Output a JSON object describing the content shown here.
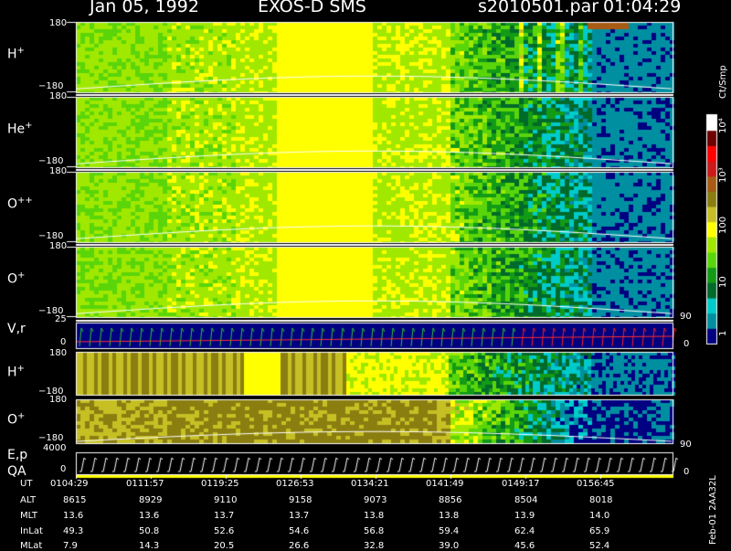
{
  "header": {
    "title_date": "Jan 05, 1992",
    "title_instrument": "EXOS-D SMS",
    "title_file": "s2010501.par",
    "title_time": "01:04:29"
  },
  "colorbar": {
    "unit_label": "Ct/Smp",
    "tick_labels": [
      "1",
      "10",
      "100",
      "10³",
      "10⁴"
    ],
    "colors": [
      "#000080",
      "#008fa0",
      "#00cbcb",
      "#006a2a",
      "#139b16",
      "#5ad50a",
      "#a0e800",
      "#ffff00",
      "#c6c025",
      "#8a7e10",
      "#a85b14",
      "#cc1a1a",
      "#ff0000",
      "#6f0000",
      "#ffffff"
    ]
  },
  "footer_tag": "Feb-01 2AA32L",
  "chart_data": {
    "type": "heatmap",
    "x_label": "UT",
    "x_ticks": [
      "0104:29",
      "0111:57",
      "0119:25",
      "0126:53",
      "0134:21",
      "0141:49",
      "0149:17",
      "0156:45"
    ],
    "panels": [
      {
        "label": "H",
        "charge": "+",
        "y_top": "180",
        "y_bottom": "−180"
      },
      {
        "label": "He",
        "charge": "+",
        "y_top": "180",
        "y_bottom": "−180"
      },
      {
        "label": "O",
        "charge": "++",
        "y_top": "180",
        "y_bottom": "−180"
      },
      {
        "label": "O",
        "charge": "+",
        "y_top": "180",
        "y_bottom": "−180",
        "right_tick": "90"
      },
      {
        "label": "V,r",
        "charge": "",
        "y_top": "25",
        "y_bottom": "0",
        "right_tick": "0"
      },
      {
        "label": "H",
        "charge": "+",
        "y_top": "180",
        "y_bottom": "−180"
      },
      {
        "label": "O",
        "charge": "+",
        "y_top": "180",
        "y_bottom": "−180",
        "right_tick": "90"
      },
      {
        "label": "E,p",
        "label2": "QA",
        "charge": "",
        "y_top": "4000",
        "y_bottom": "0",
        "right_tick": "0"
      }
    ],
    "ephemeris": {
      "rows": [
        {
          "name": "UT",
          "values": [
            "0104:29",
            "0111:57",
            "0119:25",
            "0126:53",
            "0134:21",
            "0141:49",
            "0149:17",
            "0156:45"
          ]
        },
        {
          "name": "ALT",
          "values": [
            "8615",
            "8929",
            "9110",
            "9158",
            "9073",
            "8856",
            "8504",
            "8018"
          ]
        },
        {
          "name": "MLT",
          "values": [
            "13.6",
            "13.6",
            "13.7",
            "13.7",
            "13.8",
            "13.8",
            "13.9",
            "14.0"
          ]
        },
        {
          "name": "InLat",
          "values": [
            "49.3",
            "50.8",
            "52.6",
            "54.6",
            "56.8",
            "59.4",
            "62.4",
            "65.9"
          ]
        },
        {
          "name": "MLat",
          "values": [
            "7.9",
            "14.3",
            "20.5",
            "26.6",
            "32.8",
            "39.0",
            "45.6",
            "52.4"
          ]
        }
      ]
    }
  }
}
